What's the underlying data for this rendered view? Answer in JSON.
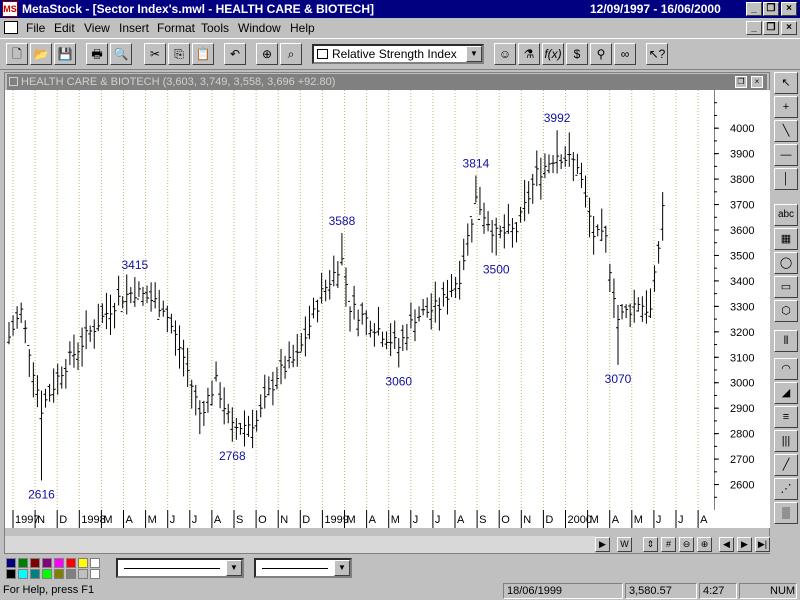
{
  "titlebar": {
    "app": "MetaStock",
    "title": "MetaStock - [Sector Index's.mwl - HEALTH CARE & BIOTECH]",
    "daterange": "12/09/1997 - 16/06/2000",
    "buttons": [
      "minimize",
      "restore",
      "close"
    ]
  },
  "menu": [
    "File",
    "Edit",
    "View",
    "Insert",
    "Format",
    "Tools",
    "Window",
    "Help"
  ],
  "toolbar": {
    "buttons": [
      "new",
      "open",
      "save",
      "print",
      "print-preview",
      "cut",
      "copy",
      "paste",
      "undo",
      "crosshair",
      "zoom"
    ],
    "indicator": "Relative Strength Index",
    "right_buttons": [
      "expert-advisor",
      "system-tester",
      "formula",
      "dollar",
      "explorer",
      "help"
    ]
  },
  "chart_window": {
    "title": "HEALTH CARE & BIOTECH (3,603, 3,749, 3,558, 3,696 +92.80)",
    "buttons": [
      "restore",
      "close"
    ]
  },
  "chart_data": {
    "type": "bar",
    "title": "HEALTH CARE & BIOTECH (3,603, 3,749, 3,558, 3,696 +92.80)",
    "ylim": [
      2500,
      4150
    ],
    "yticks": [
      2600,
      2700,
      2800,
      2900,
      3000,
      3100,
      3200,
      3300,
      3400,
      3500,
      3600,
      3700,
      3800,
      3900,
      4000
    ],
    "x_labels": [
      "1997",
      "N",
      "D",
      "1998",
      "M",
      "A",
      "M",
      "J",
      "J",
      "A",
      "S",
      "O",
      "N",
      "D",
      "1999",
      "M",
      "A",
      "M",
      "J",
      "J",
      "A",
      "S",
      "O",
      "N",
      "D",
      "2000",
      "M",
      "A",
      "M",
      "J",
      "J",
      "A"
    ],
    "grid": "vertical dotted",
    "annotations": [
      {
        "text": "2616",
        "week": 8,
        "value": 2616,
        "pos": "below"
      },
      {
        "text": "3415",
        "week": 31,
        "value": 3415,
        "pos": "above"
      },
      {
        "text": "2768",
        "week": 55,
        "value": 2768,
        "pos": "below"
      },
      {
        "text": "3588",
        "week": 82,
        "value": 3588,
        "pos": "above"
      },
      {
        "text": "3060",
        "week": 96,
        "value": 3060,
        "pos": "below"
      },
      {
        "text": "3814",
        "week": 115,
        "value": 3814,
        "pos": "above"
      },
      {
        "text": "3500",
        "week": 120,
        "value": 3500,
        "pos": "below"
      },
      {
        "text": "3992",
        "week": 135,
        "value": 3992,
        "pos": "above"
      },
      {
        "text": "3070",
        "week": 150,
        "value": 3070,
        "pos": "below"
      }
    ],
    "anchors": [
      [
        0,
        3180
      ],
      [
        3,
        3280
      ],
      [
        8,
        2900
      ],
      [
        13,
        3050
      ],
      [
        20,
        3200
      ],
      [
        27,
        3330
      ],
      [
        31,
        3360
      ],
      [
        38,
        3300
      ],
      [
        43,
        3100
      ],
      [
        47,
        2880
      ],
      [
        51,
        3000
      ],
      [
        55,
        2820
      ],
      [
        61,
        2850
      ],
      [
        66,
        3030
      ],
      [
        71,
        3100
      ],
      [
        77,
        3350
      ],
      [
        82,
        3480
      ],
      [
        84,
        3300
      ],
      [
        91,
        3210
      ],
      [
        96,
        3140
      ],
      [
        100,
        3260
      ],
      [
        106,
        3300
      ],
      [
        111,
        3420
      ],
      [
        115,
        3720
      ],
      [
        120,
        3580
      ],
      [
        125,
        3600
      ],
      [
        130,
        3820
      ],
      [
        135,
        3900
      ],
      [
        140,
        3860
      ],
      [
        144,
        3580
      ],
      [
        147,
        3560
      ],
      [
        150,
        3250
      ],
      [
        155,
        3320
      ],
      [
        158,
        3280
      ],
      [
        161,
        3660
      ]
    ],
    "last_ohlc": {
      "open": 3603,
      "high": 3749,
      "low": 3558,
      "close": 3696,
      "change": 92.8
    }
  },
  "right_tools": [
    "pointer",
    "crosshair-tool",
    "trendline",
    "horizontal-line",
    "vertical-line",
    "text-abc",
    "calendar-grid",
    "ellipse",
    "rectangle",
    "polygon",
    "fibonacci-time",
    "arc",
    "speed-resistance",
    "fan",
    "gann",
    "cycle",
    "regression",
    "raff",
    "fib-retrace"
  ],
  "scrollbar": {
    "buttons": [
      "scroll-left",
      "W",
      "updown",
      "grid",
      "zoom-out",
      "zoom-in",
      "prev",
      "next",
      "end"
    ]
  },
  "palette_colors": [
    "#000080",
    "#008000",
    "#800000",
    "#800080",
    "#ff00ff",
    "#ff0000",
    "#ffff00",
    "#ffffff",
    "#000000",
    "#00ffff",
    "#008080",
    "#00ff00",
    "#808000",
    "#808080",
    "#c0c0c0",
    "#ffffff"
  ],
  "status": {
    "help": "For Help, press F1",
    "date": "18/06/1999",
    "value": "3,580.57",
    "count": "4:27",
    "num": "NUM"
  }
}
